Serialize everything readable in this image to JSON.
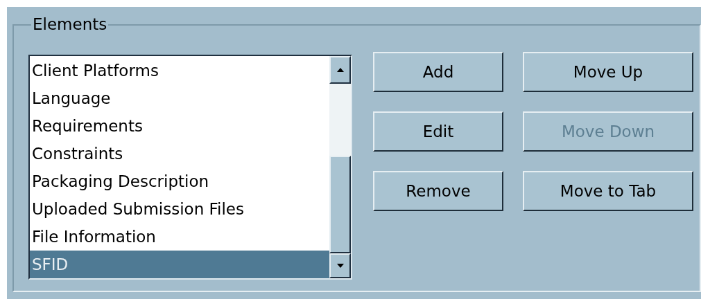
{
  "group": {
    "title": "Elements"
  },
  "list": {
    "items": [
      {
        "label": "Client Platforms",
        "selected": false
      },
      {
        "label": "Language",
        "selected": false
      },
      {
        "label": "Requirements",
        "selected": false
      },
      {
        "label": "Constraints",
        "selected": false
      },
      {
        "label": "Packaging Description",
        "selected": false
      },
      {
        "label": "Uploaded Submission Files",
        "selected": false
      },
      {
        "label": "File Information",
        "selected": false
      },
      {
        "label": "SFID",
        "selected": true
      }
    ]
  },
  "buttons": [
    {
      "label": "Add",
      "disabled": false
    },
    {
      "label": "Move Up",
      "disabled": false
    },
    {
      "label": "Edit",
      "disabled": false
    },
    {
      "label": "Move Down",
      "disabled": true
    },
    {
      "label": "Remove",
      "disabled": false
    },
    {
      "label": "Move to Tab",
      "disabled": false
    }
  ]
}
